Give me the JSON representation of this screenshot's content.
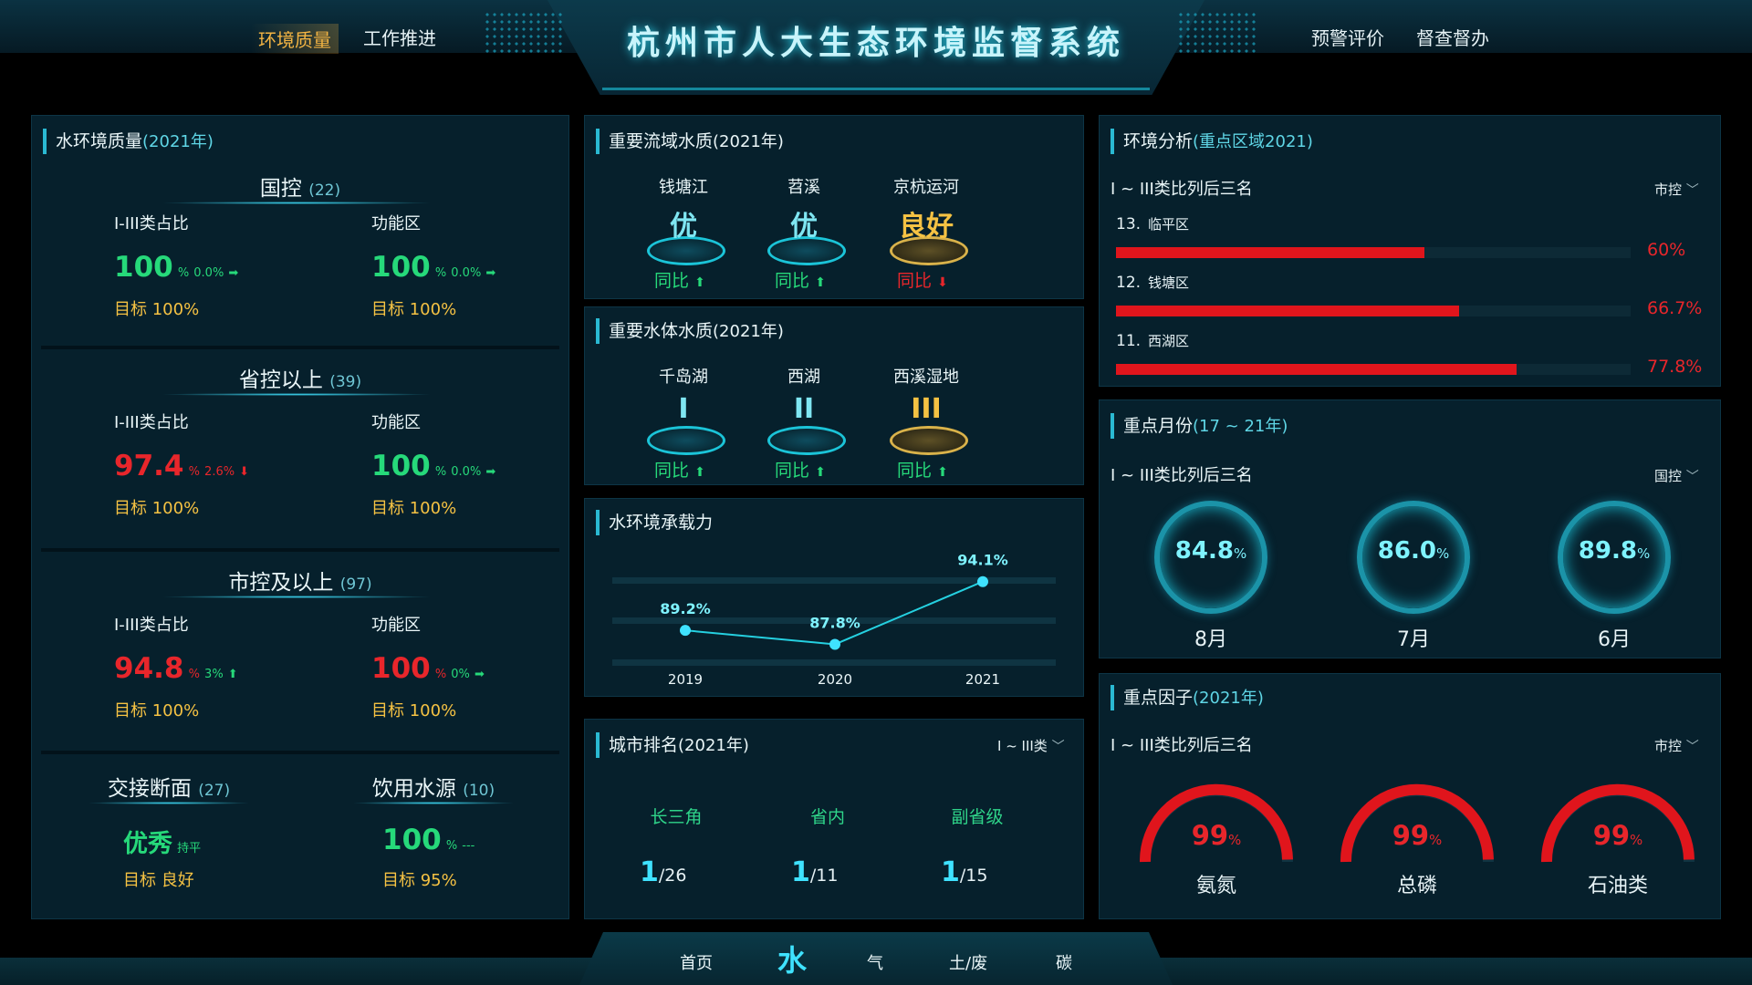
{
  "header": {
    "title": "杭州市人大生态环境监督系统",
    "tabs_left": [
      "环境质量",
      "工作推进"
    ],
    "tabs_right": [
      "预警评价",
      "督查督办"
    ]
  },
  "water_env": {
    "title": "水环境质量",
    "year": "(2021年)",
    "sections": [
      {
        "name": "国控",
        "count": "(22)",
        "left": {
          "label": "I-III类占比",
          "value": "100",
          "unit": "%",
          "delta": "0.0%",
          "arrow": "➡",
          "target": "目标 100%"
        },
        "right": {
          "label": "功能区",
          "value": "100",
          "unit": "%",
          "delta": "0.0%",
          "arrow": "➡",
          "target": "目标 100%"
        }
      },
      {
        "name": "省控以上",
        "count": "(39)",
        "left": {
          "label": "I-III类占比",
          "value": "97.4",
          "unit": "%",
          "delta": "2.6%",
          "arrow": "⬇",
          "target": "目标 100%"
        },
        "right": {
          "label": "功能区",
          "value": "100",
          "unit": "%",
          "delta": "0.0%",
          "arrow": "➡",
          "target": "目标 100%"
        }
      },
      {
        "name": "市控及以上",
        "count": "(97)",
        "left": {
          "label": "I-III类占比",
          "value": "94.8",
          "unit": "%",
          "delta": "3%",
          "arrow": "⬆",
          "target": "目标 100%"
        },
        "right": {
          "label": "功能区",
          "value": "100",
          "unit": "%",
          "delta": "0%",
          "arrow": "➡",
          "target": "目标 100%"
        }
      }
    ],
    "bottom": {
      "left": {
        "name": "交接断面",
        "count": "(27)",
        "value": "优秀",
        "status": "持平",
        "target": "目标 良好"
      },
      "right": {
        "name": "饮用水源",
        "count": "(10)",
        "value": "100",
        "unit": "%",
        "status": "---",
        "target": "目标 95%"
      }
    }
  },
  "basin": {
    "title": "重要流域水质",
    "year": "(2021年)",
    "items": [
      {
        "name": "钱塘江",
        "grade": "优",
        "yoy": "同比",
        "arrow": "⬆"
      },
      {
        "name": "苕溪",
        "grade": "优",
        "yoy": "同比",
        "arrow": "⬆"
      },
      {
        "name": "京杭运河",
        "grade": "良好",
        "yoy": "同比",
        "arrow": "⬇"
      }
    ]
  },
  "waterbody": {
    "title": "重要水体水质",
    "year": "(2021年)",
    "items": [
      {
        "name": "千岛湖",
        "grade": "I",
        "yoy": "同比",
        "arrow": "⬆"
      },
      {
        "name": "西湖",
        "grade": "II",
        "yoy": "同比",
        "arrow": "⬆"
      },
      {
        "name": "西溪湿地",
        "grade": "III",
        "yoy": "同比",
        "arrow": "⬆"
      }
    ]
  },
  "capacity": {
    "title": "水环境承载力"
  },
  "chart_data": {
    "type": "line",
    "categories": [
      "2019",
      "2020",
      "2021"
    ],
    "series": [
      {
        "values": [
          89.2,
          87.8,
          94.1
        ]
      }
    ],
    "data_labels": [
      "89.2%",
      "87.8%",
      "94.1%"
    ],
    "ylim": [
      85,
      96
    ],
    "grid": true
  },
  "city_rank": {
    "title": "城市排名",
    "year": "(2021年)",
    "filter": "I ~ III类",
    "items": [
      {
        "name": "长三角",
        "rank": "1",
        "total": "/26"
      },
      {
        "name": "省内",
        "rank": "1",
        "total": "/11"
      },
      {
        "name": "副省级",
        "rank": "1",
        "total": "/15"
      }
    ]
  },
  "env_analysis": {
    "title": "环境分析",
    "sub": "(重点区域2021)",
    "subtitle": "I ~ III类比列后三名",
    "filter": "市控",
    "items": [
      {
        "rank": "13.",
        "name": "临平区",
        "value": 60,
        "label": "60%"
      },
      {
        "rank": "12.",
        "name": "钱塘区",
        "value": 66.7,
        "label": "66.7%"
      },
      {
        "rank": "11.",
        "name": "西湖区",
        "value": 77.8,
        "label": "77.8%"
      }
    ]
  },
  "key_month": {
    "title": "重点月份",
    "sub": "(17 ~ 21年)",
    "subtitle": "I ~ III类比列后三名",
    "filter": "国控",
    "items": [
      {
        "value": "84.8",
        "unit": "%",
        "month": "8月"
      },
      {
        "value": "86.0",
        "unit": "%",
        "month": "7月"
      },
      {
        "value": "89.8",
        "unit": "%",
        "month": "6月"
      }
    ]
  },
  "key_factor": {
    "title": "重点因子",
    "sub": "(2021年)",
    "subtitle": "I ~ III类比列后三名",
    "filter": "市控",
    "items": [
      {
        "value": "99",
        "unit": "%",
        "name": "氨氮",
        "pct": 99
      },
      {
        "value": "99",
        "unit": "%",
        "name": "总磷",
        "pct": 99
      },
      {
        "value": "99",
        "unit": "%",
        "name": "石油类",
        "pct": 99
      }
    ]
  },
  "bottom_nav": [
    "首页",
    "水",
    "气",
    "土/废",
    "碳"
  ],
  "colors": {
    "accent": "#2ab9d2",
    "good": "#26d97a",
    "bad": "#e8262b",
    "warn": "#f5c243"
  }
}
